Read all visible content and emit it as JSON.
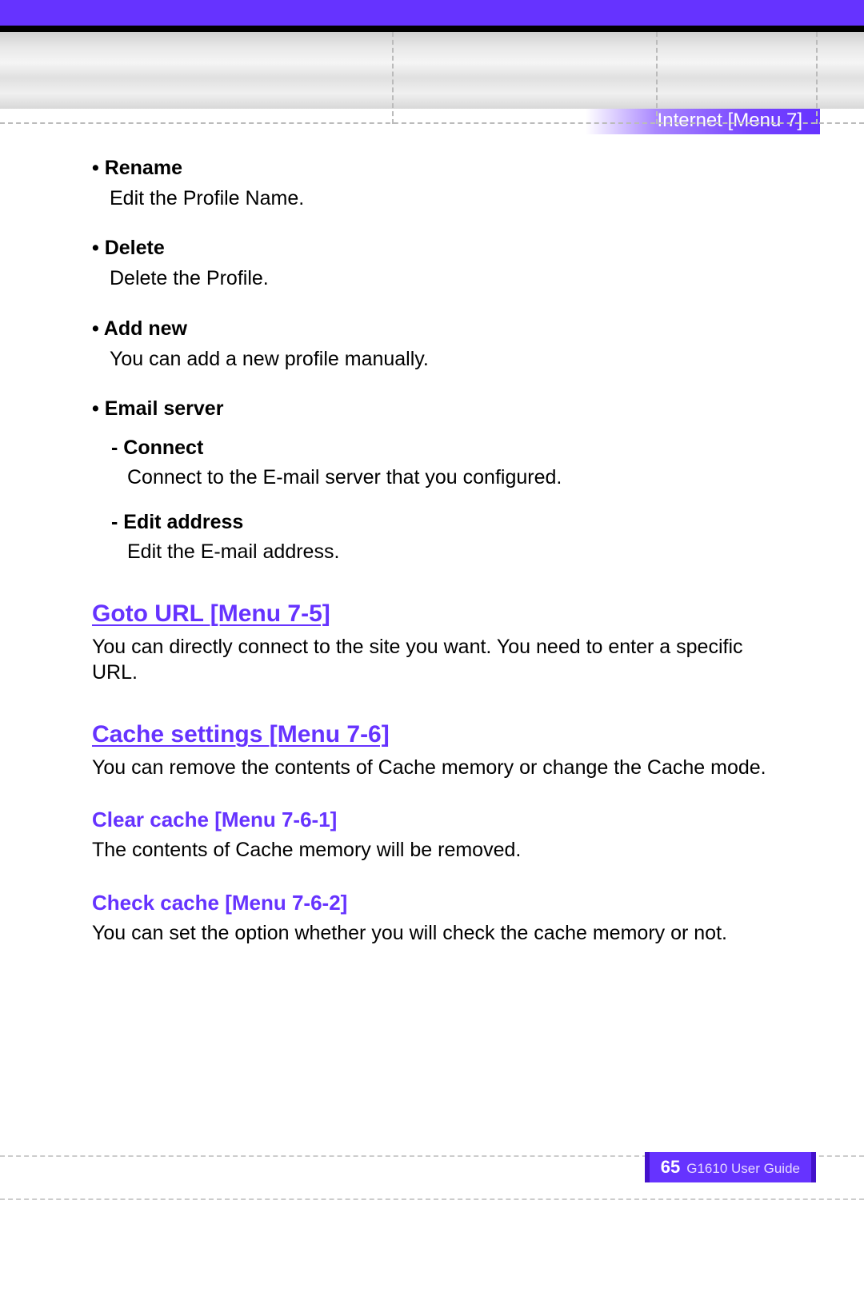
{
  "header": {
    "breadcrumb": "Internet [Menu 7]"
  },
  "bullets": [
    {
      "title": "Rename",
      "desc": "Edit the Profile Name."
    },
    {
      "title": "Delete",
      "desc": "Delete the Profile."
    },
    {
      "title": "Add new",
      "desc": "You can add a new profile manually."
    },
    {
      "title": "Email server",
      "desc": ""
    }
  ],
  "email_subs": [
    {
      "title": "Connect",
      "desc": "Connect to the E-mail server that you configured."
    },
    {
      "title": "Edit address",
      "desc": "Edit the E-mail address."
    }
  ],
  "sections": [
    {
      "heading": "Goto URL [Menu 7-5]",
      "body": "You can directly connect to the site you want. You need to enter a specific URL."
    },
    {
      "heading": "Cache settings [Menu 7-6]",
      "body": "You can remove the contents of Cache memory or change the Cache mode."
    }
  ],
  "subsections": [
    {
      "heading": "Clear cache [Menu 7-6-1]",
      "body": "The contents of Cache memory will be removed."
    },
    {
      "heading": "Check cache [Menu 7-6-2]",
      "body": "You can set the option whether you will check the cache memory or not."
    }
  ],
  "footer": {
    "page": "65",
    "label": "G1610 User Guide"
  }
}
